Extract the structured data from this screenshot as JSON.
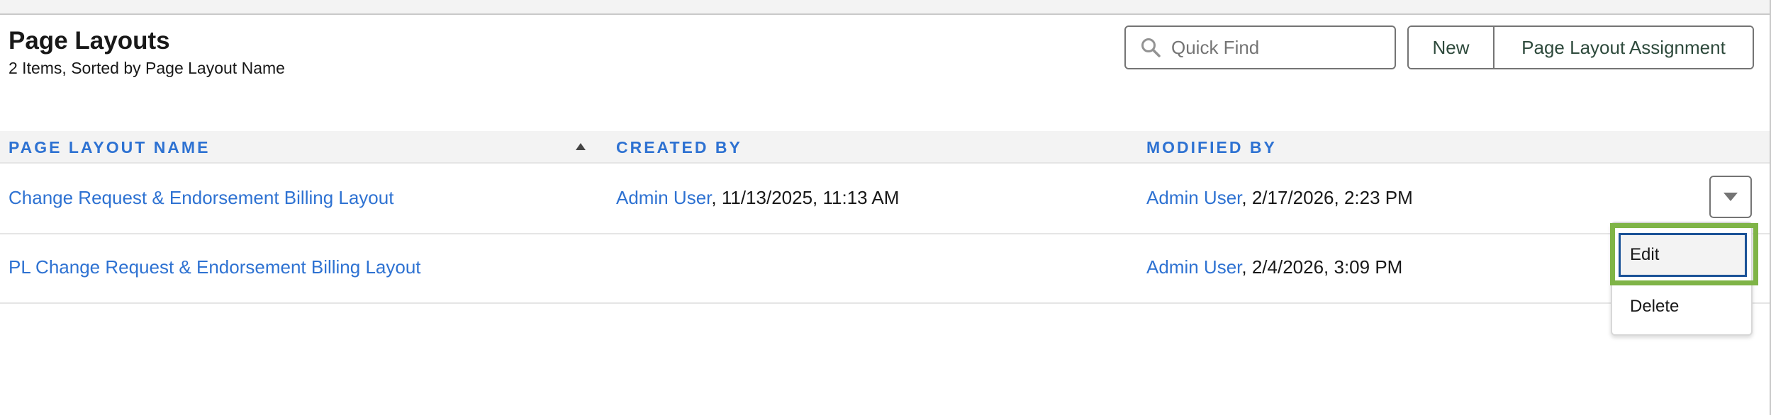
{
  "header": {
    "title": "Page Layouts",
    "subtitle": "2 Items, Sorted by Page Layout Name"
  },
  "search": {
    "placeholder": "Quick Find",
    "value": ""
  },
  "buttons": {
    "new_label": "New",
    "assignment_label": "Page Layout Assignment"
  },
  "table": {
    "columns": [
      "PAGE LAYOUT NAME",
      "CREATED BY",
      "MODIFIED BY"
    ],
    "rows": [
      {
        "name": "Change Request & Endorsement Billing Layout",
        "created_by_user": "Admin User",
        "created_at": ", 11/13/2025, 11:13 AM",
        "modified_by_user": "Admin User",
        "modified_at": ", 2/17/2026, 2:23 PM"
      },
      {
        "name": "PL Change Request & Endorsement Billing Layout",
        "created_by_user": "",
        "created_at": "",
        "modified_by_user": "Admin User",
        "modified_at": ", 2/4/2026, 3:09 PM"
      }
    ]
  },
  "row_menu": {
    "items": [
      "Edit",
      "Delete"
    ]
  },
  "icons": {
    "search": "search-icon",
    "sort": "sort-ascending-icon",
    "row_action": "chevron-down-icon"
  },
  "colors": {
    "link": "#2e72d2",
    "highlight": "#7fb447",
    "focus": "#1b5297"
  }
}
